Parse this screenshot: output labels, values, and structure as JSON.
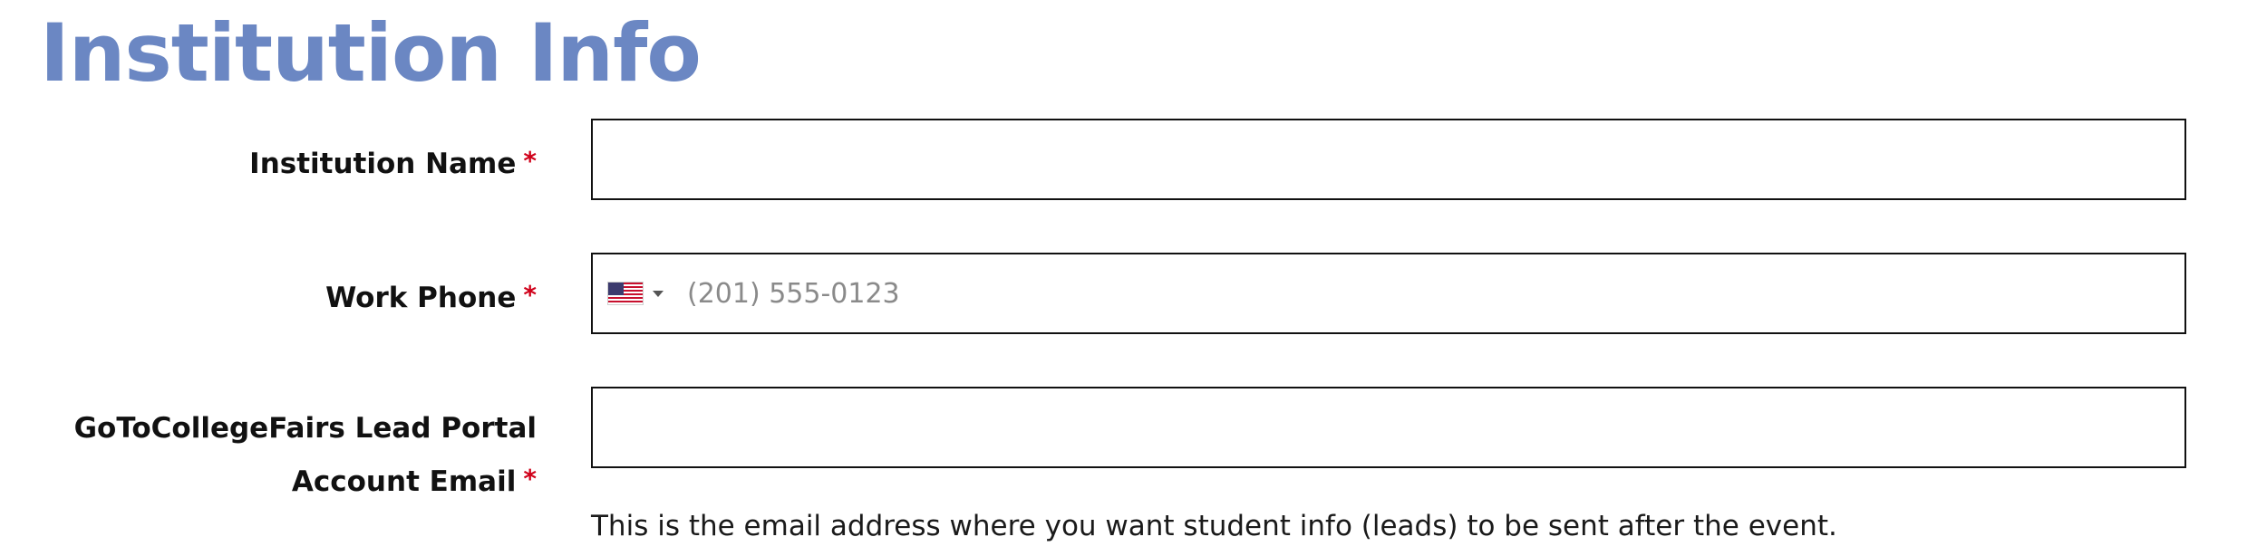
{
  "section": {
    "title": "Institution Info"
  },
  "form": {
    "required_marker": "*",
    "institution_name": {
      "label": "Institution Name",
      "value": "",
      "placeholder": ""
    },
    "work_phone": {
      "label": "Work Phone",
      "value": "",
      "placeholder": "(201) 555-0123",
      "country_flag_icon": "us-flag-icon",
      "country_code": "US"
    },
    "lead_portal_email": {
      "label_line1": "GoToCollegeFairs Lead Portal",
      "label_line2": "Account Email",
      "value": "",
      "placeholder": "",
      "helper_text": "This is the email address where you want student info (leads) to be sent after the event."
    }
  },
  "colors": {
    "heading": "#6b87c3",
    "required": "#d0021b",
    "border": "#111111"
  }
}
